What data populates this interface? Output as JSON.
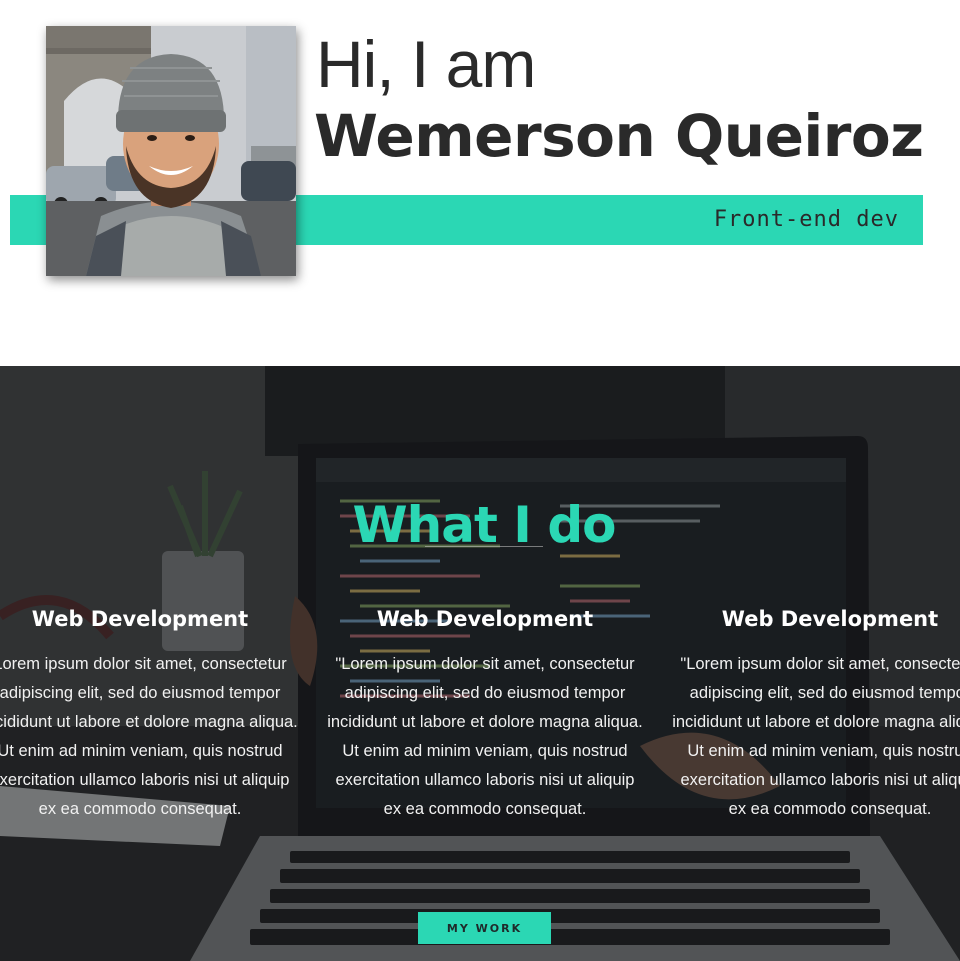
{
  "hero": {
    "greeting": "Hi, I am",
    "name": "Wemerson Queiroz",
    "role": "Front-end dev",
    "accent_color": "#2bd7b4"
  },
  "what_i_do": {
    "title": "What I do",
    "services": [
      {
        "title": "Web Development",
        "description": "Lorem ipsum dolor sit amet, consectetur adipiscing elit, sed do eiusmod tempor incididunt ut labore et dolore magna aliqua. Ut enim ad minim veniam, quis nostrud exercitation ullamco laboris nisi ut aliquip ex ea commodo consequat."
      },
      {
        "title": "Web Development",
        "description": "\"Lorem ipsum dolor sit amet, consectetur adipiscing elit, sed do eiusmod tempor incididunt ut labore et dolore magna aliqua. Ut enim ad minim veniam, quis nostrud exercitation ullamco laboris nisi ut aliquip ex ea commodo consequat."
      },
      {
        "title": "Web Development",
        "description": "\"Lorem ipsum dolor sit amet, consectetur adipiscing elit, sed do eiusmod tempor incididunt ut labore et dolore magna aliqua. Ut enim ad minim veniam, quis nostrud exercitation ullamco laboris nisi ut aliquip ex ea commodo consequat."
      }
    ],
    "button_label": "MY WORK"
  }
}
